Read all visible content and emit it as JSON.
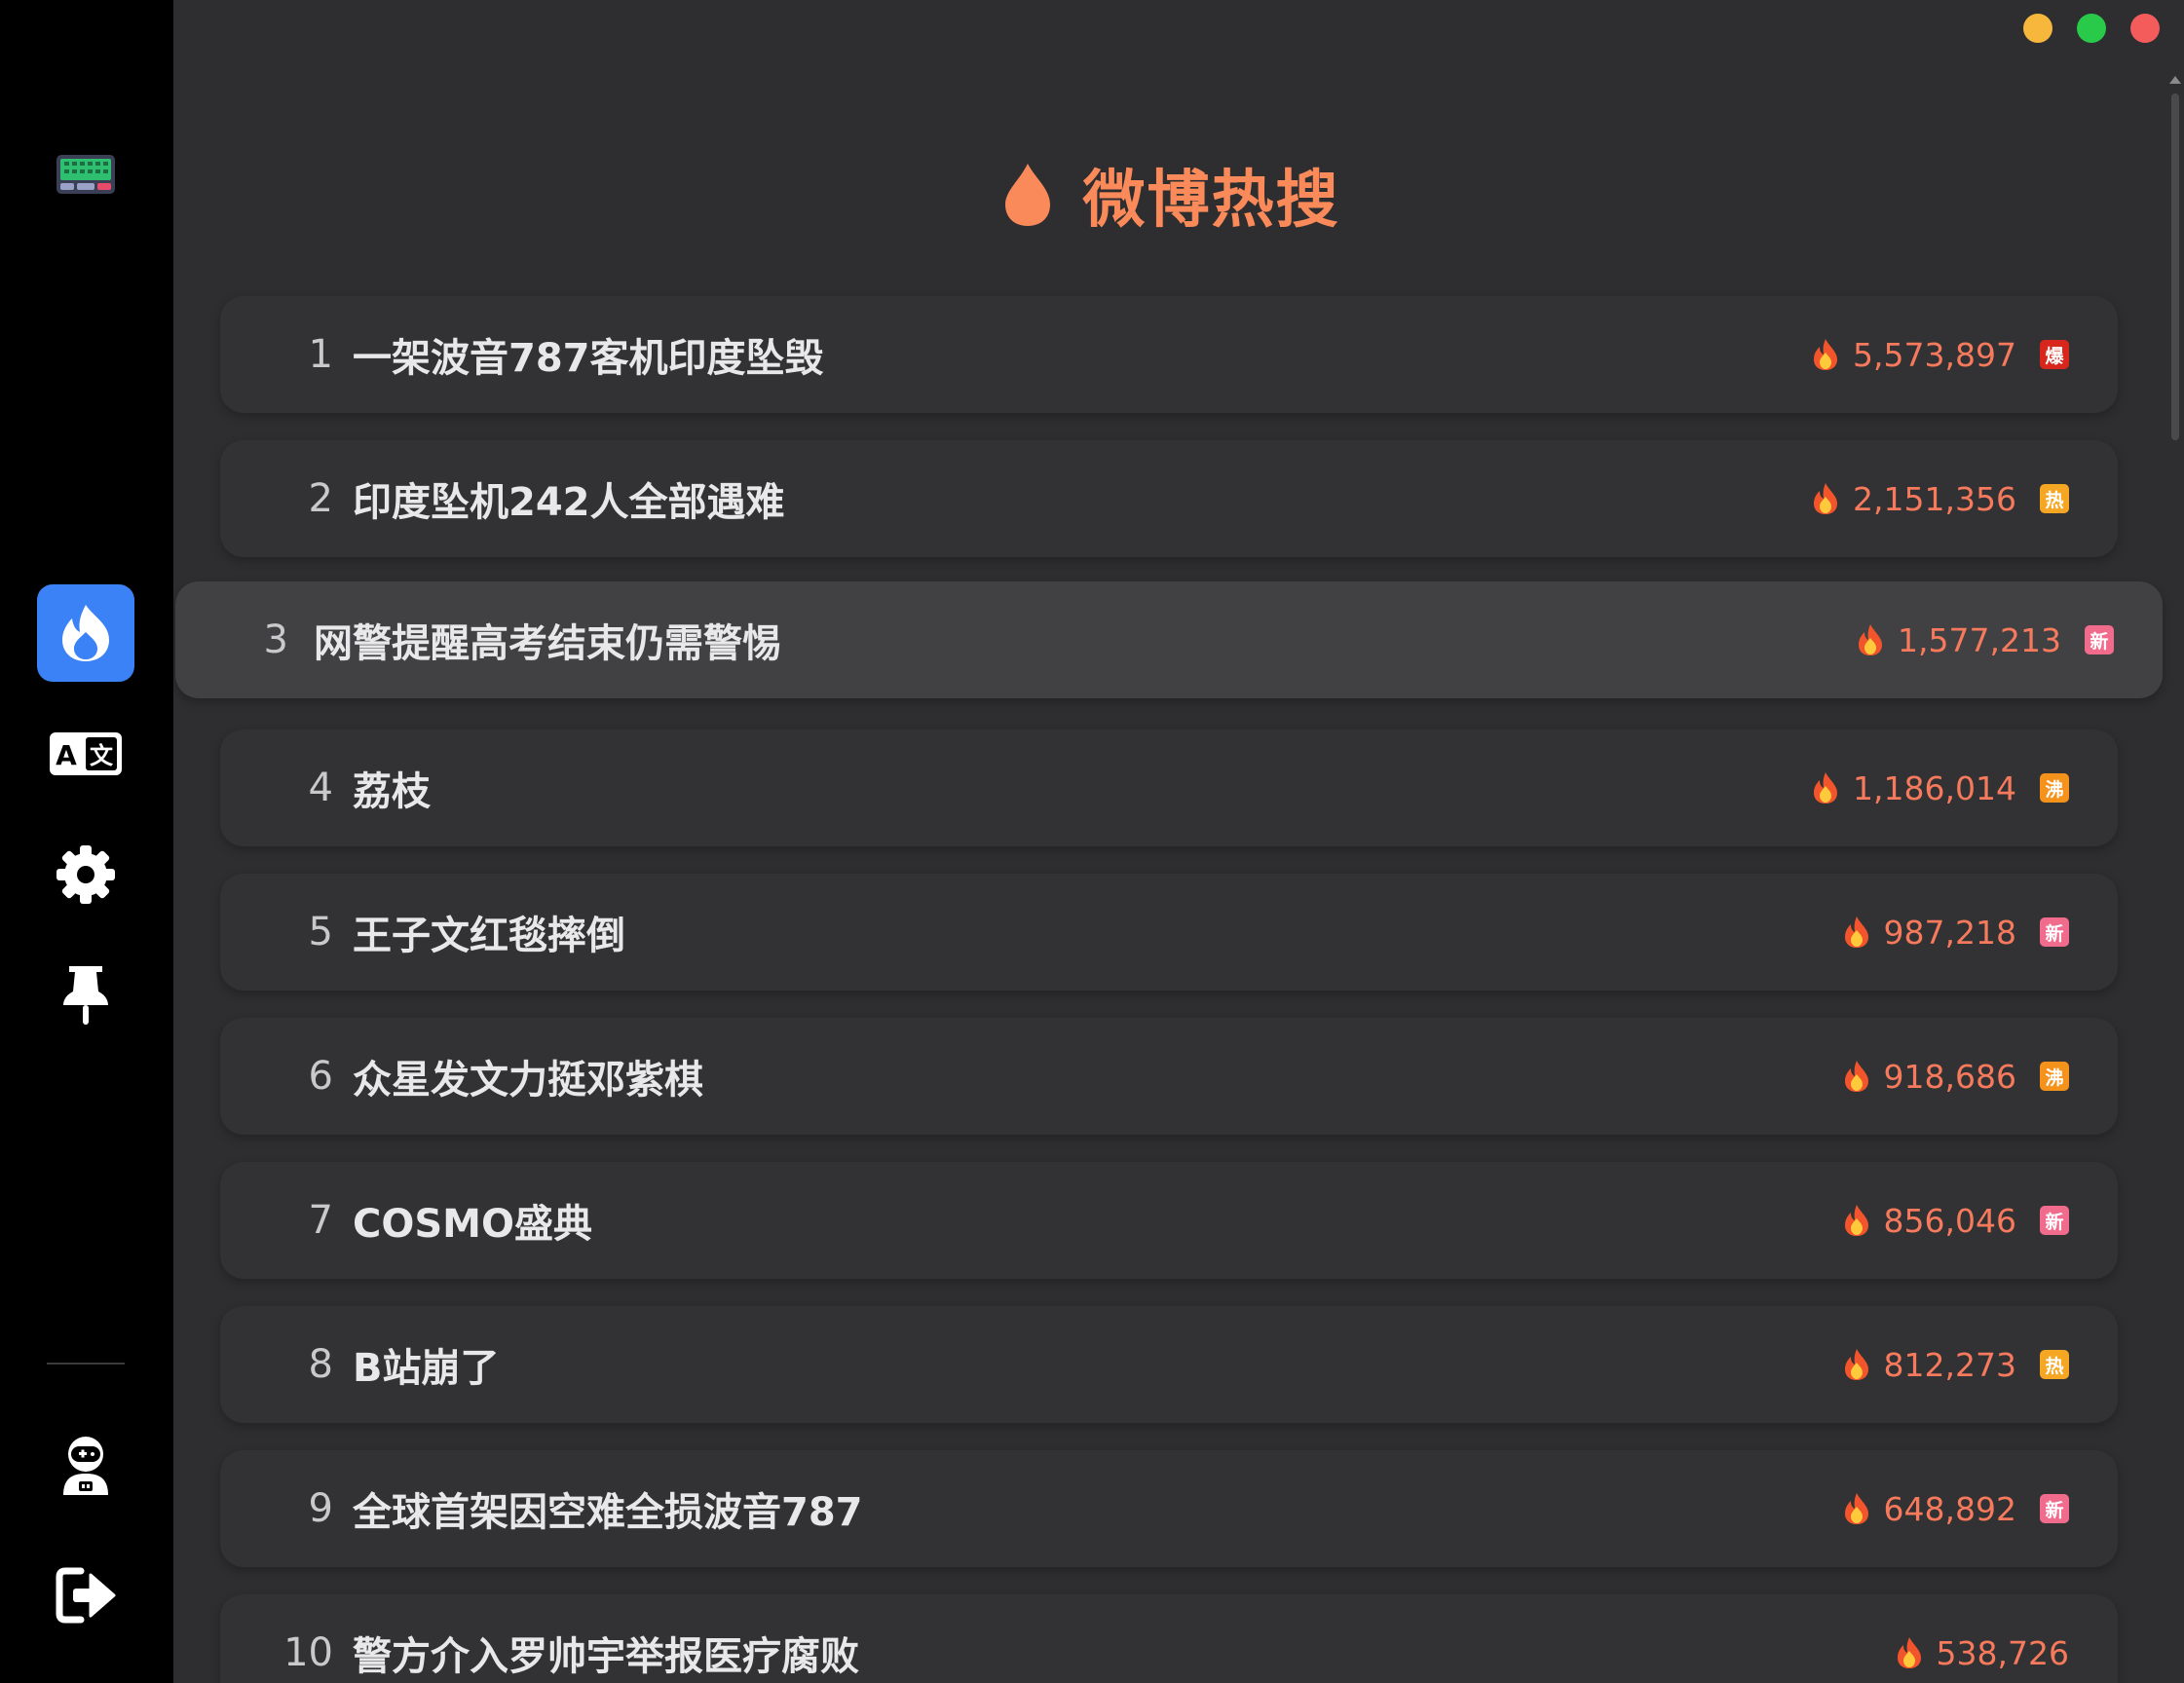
{
  "header": {
    "title": "微博热搜",
    "icon": "flame-icon"
  },
  "sidebar": {
    "items": [
      {
        "name": "keyboard-app",
        "icon": "keyboard-icon"
      },
      {
        "name": "hot-search",
        "icon": "flame-icon",
        "active": true
      },
      {
        "name": "translate",
        "icon": "translate-icon"
      },
      {
        "name": "settings",
        "icon": "gear-icon"
      },
      {
        "name": "pin",
        "icon": "pin-icon"
      },
      {
        "name": "profile",
        "icon": "astronaut-icon"
      },
      {
        "name": "logout",
        "icon": "logout-icon"
      }
    ]
  },
  "colors": {
    "accent": "#fb8a5a",
    "active": "#3b82f6",
    "badge_bao": "#d9261c",
    "badge_re": "#f5a623",
    "badge_xin": "#f16b8d",
    "badge_fei": "#f5921b"
  },
  "list": [
    {
      "rank": "1",
      "title": "一架波音787客机印度坠毁",
      "heat": "5,573,897",
      "badge": "爆"
    },
    {
      "rank": "2",
      "title": "印度坠机242人全部遇难",
      "heat": "2,151,356",
      "badge": "热"
    },
    {
      "rank": "3",
      "title": "网警提醒高考结束仍需警惕",
      "heat": "1,577,213",
      "badge": "新"
    },
    {
      "rank": "4",
      "title": "荔枝",
      "heat": "1,186,014",
      "badge": "沸"
    },
    {
      "rank": "5",
      "title": "王子文红毯摔倒",
      "heat": "987,218",
      "badge": "新"
    },
    {
      "rank": "6",
      "title": "众星发文力挺邓紫棋",
      "heat": "918,686",
      "badge": "沸"
    },
    {
      "rank": "7",
      "title": "COSMO盛典",
      "heat": "856,046",
      "badge": "新"
    },
    {
      "rank": "8",
      "title": "B站崩了",
      "heat": "812,273",
      "badge": "热"
    },
    {
      "rank": "9",
      "title": "全球首架因空难全损波音787",
      "heat": "648,892",
      "badge": "新"
    },
    {
      "rank": "10",
      "title": "警方介入罗帅宇举报医疗腐败",
      "heat": "538,726",
      "badge": ""
    }
  ]
}
